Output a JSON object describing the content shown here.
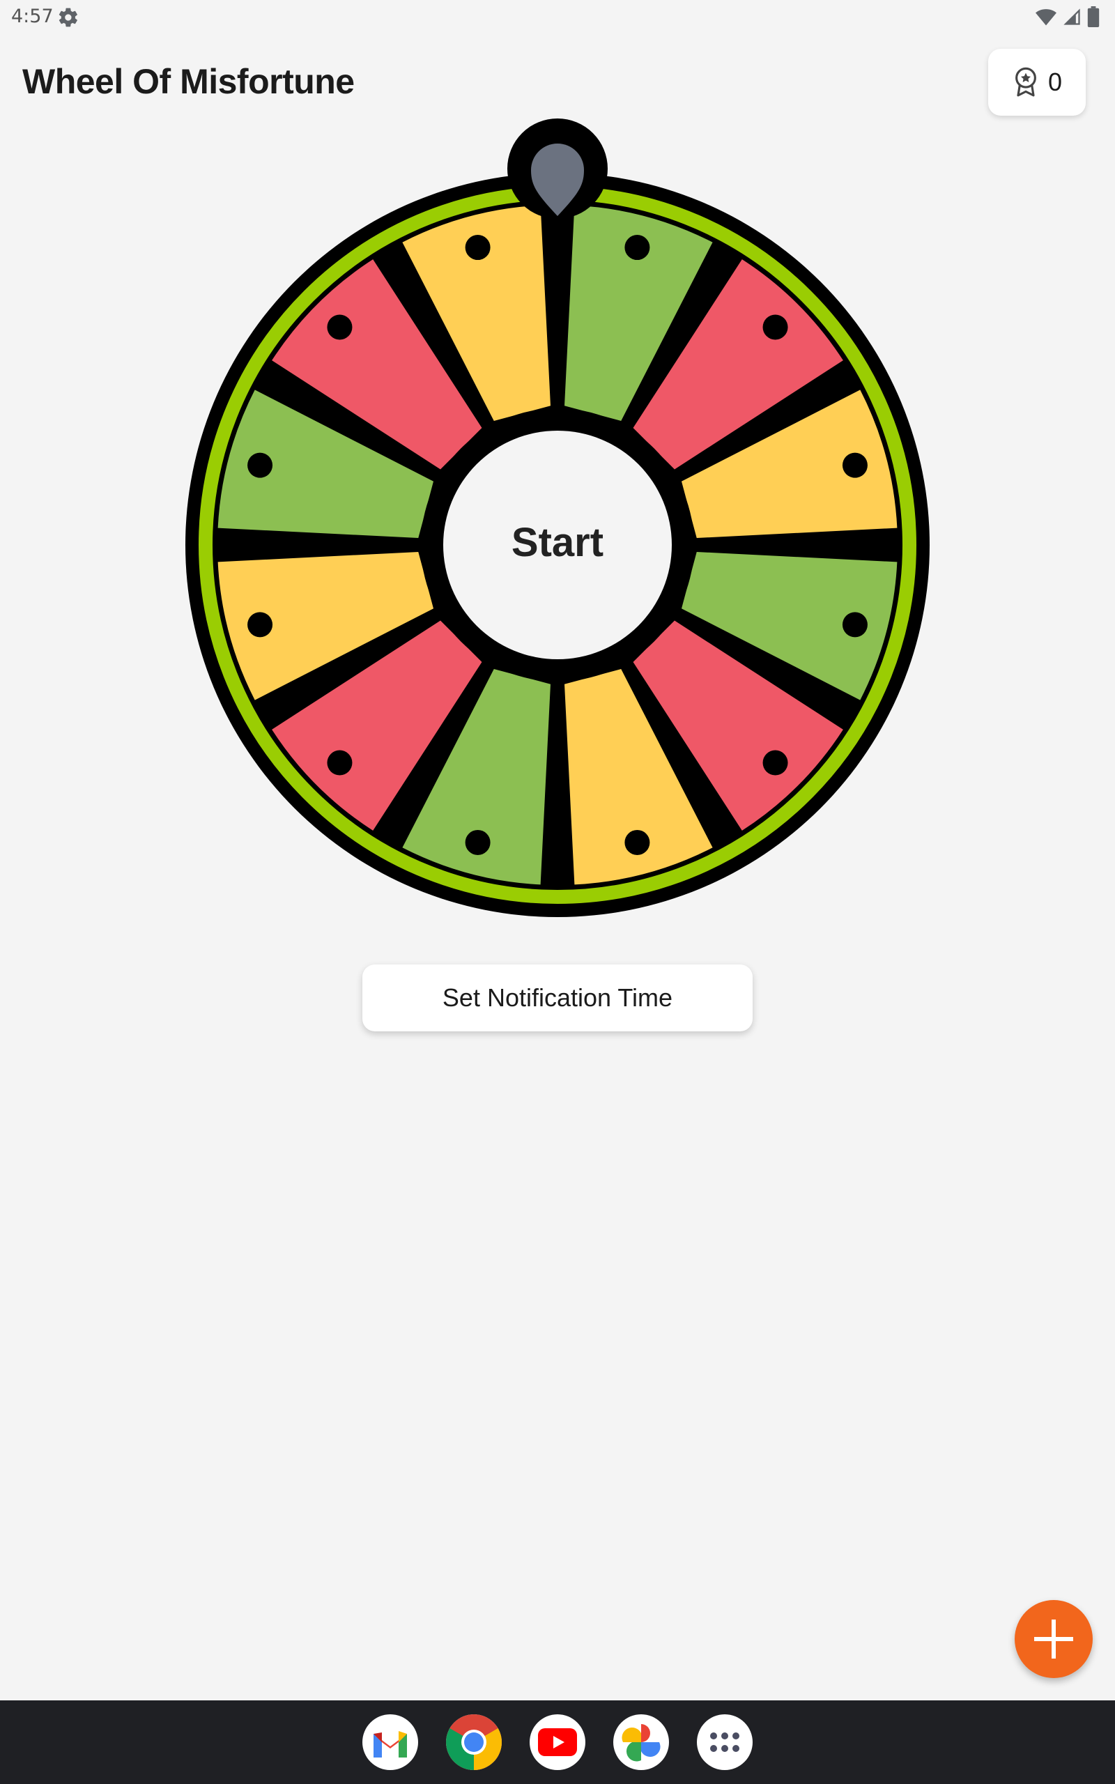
{
  "status_bar": {
    "time": "4:57",
    "icons": [
      "gear-icon",
      "wifi-icon",
      "signal-icon",
      "battery-icon"
    ]
  },
  "header": {
    "title": "Wheel Of Misfortune",
    "score_icon": "award-badge-icon",
    "score": "0"
  },
  "wheel": {
    "center_label": "Start",
    "segment_colors": [
      "#8cbf52",
      "#ef5867",
      "#ffcf55",
      "#8cbf52",
      "#ef5867",
      "#ffcf55",
      "#8cbf52",
      "#ef5867",
      "#ffcf55",
      "#8cbf52",
      "#ef5867",
      "#ffcf55"
    ],
    "rim_color": "#9acd03",
    "pointer_color": "#6b7280",
    "segment_count": 12
  },
  "actions": {
    "notification_button": "Set Notification Time"
  },
  "fab": {
    "icon": "plus-icon",
    "color": "#f2661c"
  },
  "dock": {
    "apps": [
      "gmail-icon",
      "chrome-icon",
      "youtube-icon",
      "photos-icon",
      "app-drawer-icon"
    ]
  }
}
